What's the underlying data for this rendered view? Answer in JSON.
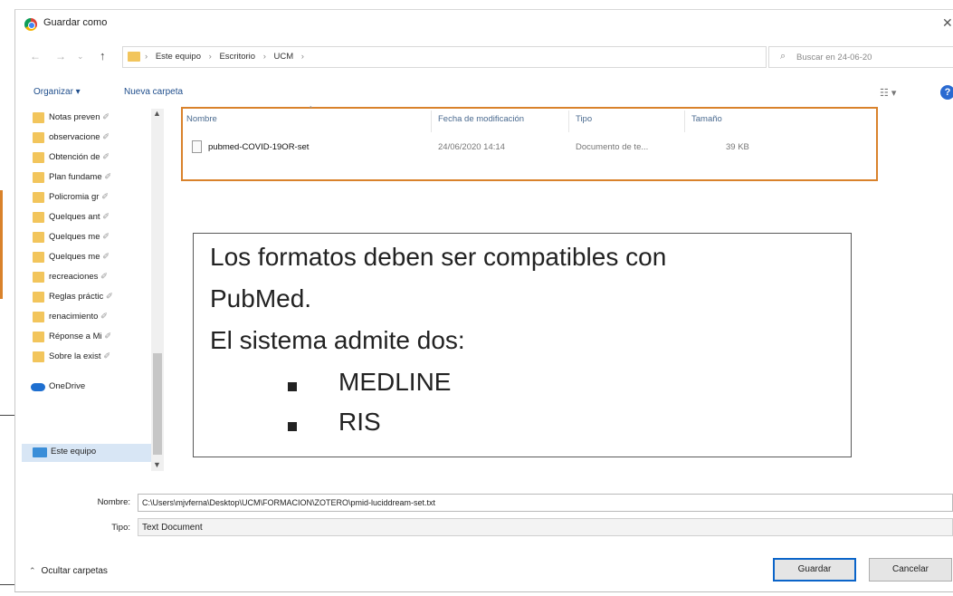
{
  "window": {
    "title": "Guardar como"
  },
  "address": {
    "crumbs": [
      "Este equipo",
      "Escritorio",
      "UCM"
    ],
    "search_placeholder": "Buscar en 24-06-20"
  },
  "toolbar": {
    "organize": "Organizar ▾",
    "new_folder": "Nueva carpeta"
  },
  "sidebar": {
    "folders": [
      "Notas preven",
      "observacione",
      "Obtención de",
      "Plan fundame",
      "Policromia gr",
      "Quelques ant",
      "Quelques me",
      "Quelques me",
      "recreaciones",
      "Reglas práctic",
      "renacimiento",
      "Réponse a Mi",
      "Sobre la exist"
    ],
    "pin": "✐",
    "onedrive": "OneDrive",
    "this_pc": "Este equipo"
  },
  "file_list": {
    "columns": [
      "Nombre",
      "Fecha de modificación",
      "Tipo",
      "Tamaño"
    ],
    "rows": [
      {
        "name": "pubmed-COVID-19OR-set",
        "date": "24/06/2020 14:14",
        "type": "Documento de te...",
        "size": "39 KB"
      }
    ]
  },
  "callout": {
    "line1": "Los formatos deben ser compatibles con",
    "line2": "PubMed.",
    "line3": "El sistema admite dos:",
    "bullets": [
      "MEDLINE",
      "RIS"
    ]
  },
  "form": {
    "name_label": "Nombre:",
    "name_value": "C:\\Users\\mjvferna\\Desktop\\UCM\\FORMACION\\ZOTERO\\pmid-luciddream-set.txt",
    "type_label": "Tipo:",
    "type_value": "Text Document"
  },
  "footer": {
    "hide_folders": "Ocultar carpetas",
    "save": "Guardar",
    "cancel": "Cancelar"
  },
  "colors": {
    "highlight_border": "#d9822b",
    "link": "#1f4e8c",
    "primary_button_border": "#0a64c9"
  }
}
